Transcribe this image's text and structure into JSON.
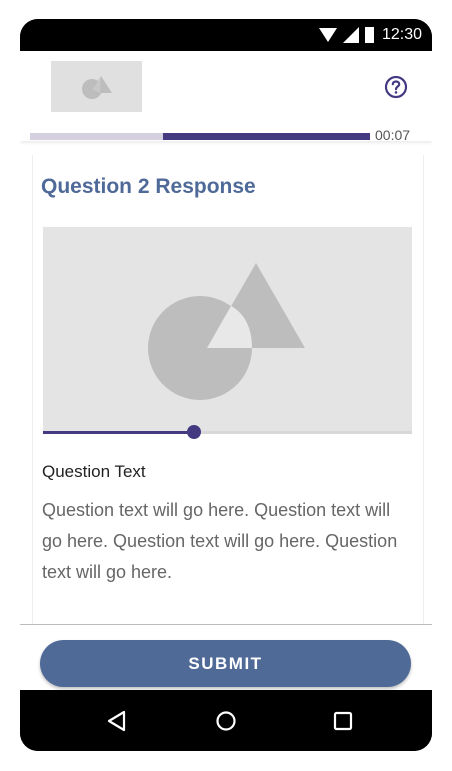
{
  "status_bar": {
    "time": "12:30",
    "icons": [
      "wifi-icon",
      "cell-signal-icon",
      "battery-icon"
    ]
  },
  "header": {
    "logo_icon": "logo-placeholder-icon",
    "help_icon": "help-icon"
  },
  "timer": {
    "label": "00:07",
    "remaining_fraction": 0.61
  },
  "question": {
    "title": "Question 2 Response",
    "media_icon": "image-placeholder-icon",
    "media_progress_fraction": 0.41,
    "label": "Question Text",
    "body": "Question text will go here. Question text will go here. Question text will go here. Question text will go here."
  },
  "actions": {
    "submit_label": "SUBMIT"
  },
  "nav": {
    "back_icon": "back-triangle-icon",
    "home_icon": "home-circle-icon",
    "recents_icon": "recents-square-icon"
  },
  "colors": {
    "accent": "#433a82",
    "title": "#4f6a98",
    "button": "#506a98"
  }
}
